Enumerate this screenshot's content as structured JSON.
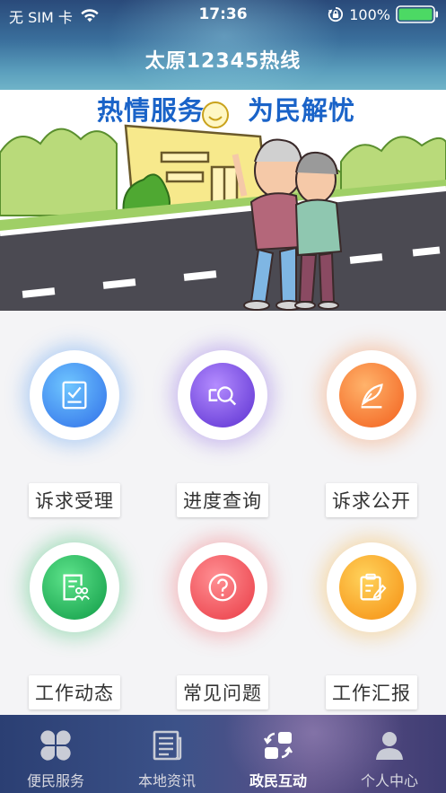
{
  "status_bar": {
    "carrier": "无 SIM 卡",
    "time": "17:36",
    "battery_percent": "100%",
    "battery_level": 1.0,
    "battery_color": "#4cd964"
  },
  "header": {
    "title": "太原12345热线"
  },
  "banner": {
    "slogan_left": "热情服务",
    "slogan_right": "为民解忧"
  },
  "services": [
    {
      "label": "诉求受理",
      "icon": "document-check-icon",
      "color": "#3b8df1"
    },
    {
      "label": "进度查询",
      "icon": "search-progress-icon",
      "color": "#7b4fe0"
    },
    {
      "label": "诉求公开",
      "icon": "quill-icon",
      "color": "#f7803a"
    },
    {
      "label": "工作动态",
      "icon": "report-people-icon",
      "color": "#1cb85a"
    },
    {
      "label": "常见问题",
      "icon": "question-icon",
      "color": "#f2555c"
    },
    {
      "label": "工作汇报",
      "icon": "clipboard-edit-icon",
      "color": "#f7a826"
    }
  ],
  "tabbar": {
    "active_index": 2,
    "tabs": [
      {
        "label": "便民服务",
        "icon": "clover-grid-icon"
      },
      {
        "label": "本地资讯",
        "icon": "newspaper-icon"
      },
      {
        "label": "政民互动",
        "icon": "exchange-icon"
      },
      {
        "label": "个人中心",
        "icon": "user-icon"
      }
    ]
  }
}
